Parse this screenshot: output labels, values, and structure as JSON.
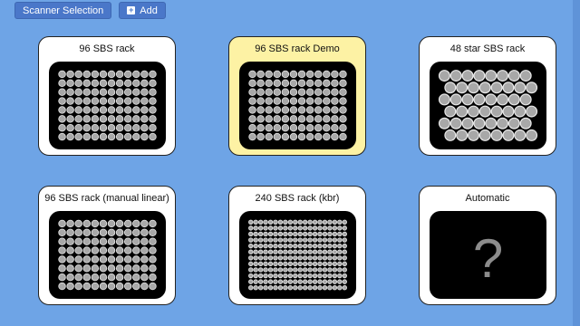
{
  "toolbar": {
    "scanner_label": "Scanner Selection",
    "add_label": "Add"
  },
  "racks": [
    {
      "label": "96 SBS rack",
      "layout": "grid",
      "rows": 8,
      "cols": 12,
      "selected": false
    },
    {
      "label": "96 SBS rack Demo",
      "layout": "grid",
      "rows": 8,
      "cols": 12,
      "selected": true
    },
    {
      "label": "48 star SBS rack",
      "layout": "stagger",
      "rows": 6,
      "cols": 8,
      "selected": false
    },
    {
      "label": "96 SBS rack (manual linear)",
      "layout": "grid",
      "rows": 8,
      "cols": 12,
      "selected": false
    },
    {
      "label": "240 SBS rack (kbr)",
      "layout": "grid",
      "rows": 12,
      "cols": 20,
      "selected": false
    },
    {
      "label": "Automatic",
      "layout": "unknown",
      "glyph": "?",
      "selected": false
    }
  ],
  "colors": {
    "background": "#6ea4e6",
    "button": "#4a77c9",
    "selected_card": "#fdf2a4",
    "well_fill": "#a8a8a8",
    "well_stroke": "#e8e8e8"
  }
}
